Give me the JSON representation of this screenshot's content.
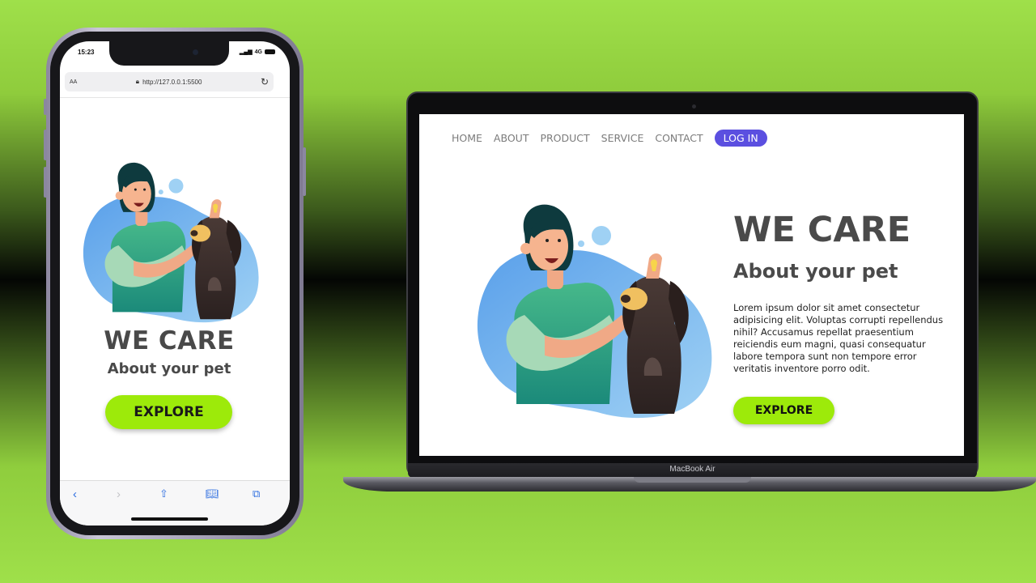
{
  "phone": {
    "status_time": "15:23",
    "status_network": "4G",
    "address_aa": "AA",
    "url": "http://127.0.0.1:5500",
    "hero_title": "WE CARE",
    "hero_subtitle": "About your pet",
    "cta": "EXPLORE",
    "toolbar_icons": [
      "back-icon",
      "forward-icon",
      "share-icon",
      "bookmarks-icon",
      "tabs-icon"
    ]
  },
  "laptop": {
    "brand": "MacBook Air",
    "nav": [
      "HOME",
      "ABOUT",
      "PRODUCT",
      "SERVICE",
      "CONTACT"
    ],
    "login": "LOG IN",
    "hero_title": "WE CARE",
    "hero_subtitle": "About your pet",
    "body": "Lorem ipsum dolor sit amet consectetur adipisicing elit. Voluptas corrupti repellendus nihil? Accusamus repellat praesentium reiciendis eum magni, quasi consequatur labore tempora sunt non tempore error veritatis inventore porro odit.",
    "cta": "EXPLORE"
  },
  "colors": {
    "accent_green": "#9dea0a",
    "login_purple": "#5b4fe0",
    "heading_gray": "#4a4a4a",
    "background_green": "#9fe04a"
  }
}
